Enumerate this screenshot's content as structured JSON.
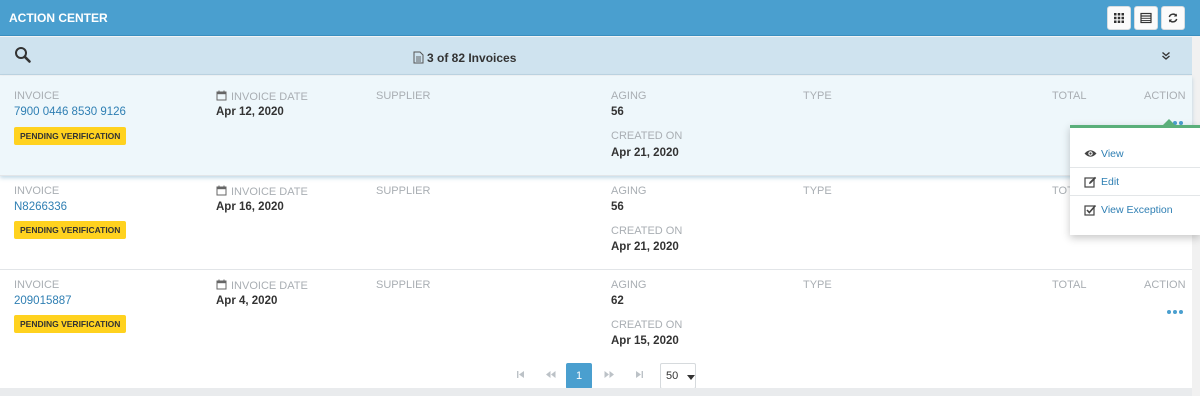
{
  "header": {
    "title": "ACTION CENTER",
    "buttons": [
      "grid-view-icon",
      "table-view-icon",
      "refresh-icon"
    ]
  },
  "searchbar": {
    "count_text": "3 of 82 Invoices"
  },
  "labels": {
    "invoice": "INVOICE",
    "invoice_date": "INVOICE DATE",
    "supplier": "SUPPLIER",
    "aging": "AGING",
    "created_on": "CREATED ON",
    "type": "TYPE",
    "total": "TOTAL",
    "action": "ACTION"
  },
  "rows": [
    {
      "invoice": "7900 0446 8530 9126",
      "status": "PENDING VERIFICATION",
      "invoice_date": "Apr 12, 2020",
      "aging": "56",
      "created_on": "Apr 21, 2020"
    },
    {
      "invoice": "N8266336",
      "status": "PENDING VERIFICATION",
      "invoice_date": "Apr 16, 2020",
      "aging": "56",
      "created_on": "Apr 21, 2020"
    },
    {
      "invoice": "209015887",
      "status": "PENDING VERIFICATION",
      "invoice_date": "Apr 4, 2020",
      "aging": "62",
      "created_on": "Apr 15, 2020"
    }
  ],
  "action_menu": {
    "items": [
      {
        "label": "View",
        "icon": "eye-icon"
      },
      {
        "label": "Edit",
        "icon": "edit-icon"
      },
      {
        "label": "View Exception",
        "icon": "checkbox-icon"
      }
    ]
  },
  "pager": {
    "current_page": "1",
    "page_size": "50"
  },
  "colors": {
    "header": "#4a9fcf",
    "searchbar": "#cfe3ef",
    "badge": "#ffd21f",
    "link": "#2f7fb3",
    "menu_accent": "#5aaf7a"
  }
}
